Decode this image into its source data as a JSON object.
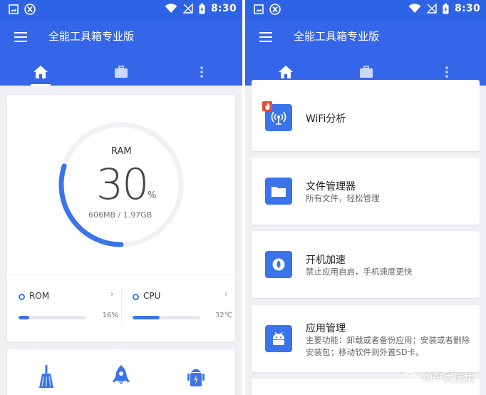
{
  "status_bar": {
    "time": "8:30"
  },
  "app": {
    "title": "全能工具箱专业版"
  },
  "colors": {
    "primary": "#3566ea",
    "statusbar": "#2f63e6",
    "accent": "#3b74ea",
    "badge": "#e94b3c"
  },
  "tabs": [
    {
      "icon": "home-icon",
      "active": true
    },
    {
      "icon": "briefcase-icon",
      "active": false
    },
    {
      "icon": "more-vertical-icon",
      "active": false
    }
  ],
  "ram": {
    "label": "RAM",
    "value": "30",
    "unit": "%",
    "percent": 30,
    "detail": "606MB / 1.97GB"
  },
  "rom": {
    "name": "ROM",
    "value": "16%",
    "percent": 16
  },
  "cpu": {
    "name": "CPU",
    "value": "32℃",
    "percent": 40
  },
  "tools": [
    {
      "icon": "broom-icon"
    },
    {
      "icon": "rocket-icon"
    },
    {
      "icon": "android-battery-icon"
    }
  ],
  "features": [
    {
      "icon": "wifi-analyzer-icon",
      "title": "WiFi分析",
      "desc": "",
      "hot": true
    },
    {
      "icon": "folder-icon",
      "title": "文件管理器",
      "desc": "所有文件，轻松管理"
    },
    {
      "icon": "boot-speed-icon",
      "title": "开机加速",
      "desc": "禁止应用自启，手机速度更快"
    },
    {
      "icon": "android-icon",
      "title": "应用管理",
      "desc": "主要功能：卸载或者备份应用；安装或者删除安装包；移动软件到外置SD卡。"
    }
  ],
  "watermark": {
    "text": "APP优选集"
  }
}
